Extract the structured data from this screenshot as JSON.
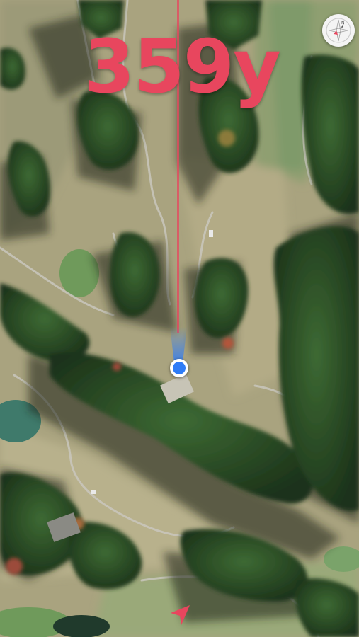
{
  "distance": {
    "text": "359y"
  },
  "compass": {
    "icon": "compass-icon"
  },
  "location": {
    "icon": "current-location-icon",
    "heading_icon": "heading-cone-icon"
  },
  "target_line": {
    "icon": "target-line-icon"
  },
  "navigation": {
    "icon": "navigation-arrow-icon"
  },
  "colors": {
    "accent": "#e8465e",
    "location_blue": "#2f7cf6",
    "fairway_light": "#b7b08b",
    "rough_green": "#6d8a5b",
    "tree_dark": "#26421f",
    "water": "#3f7a6b"
  }
}
